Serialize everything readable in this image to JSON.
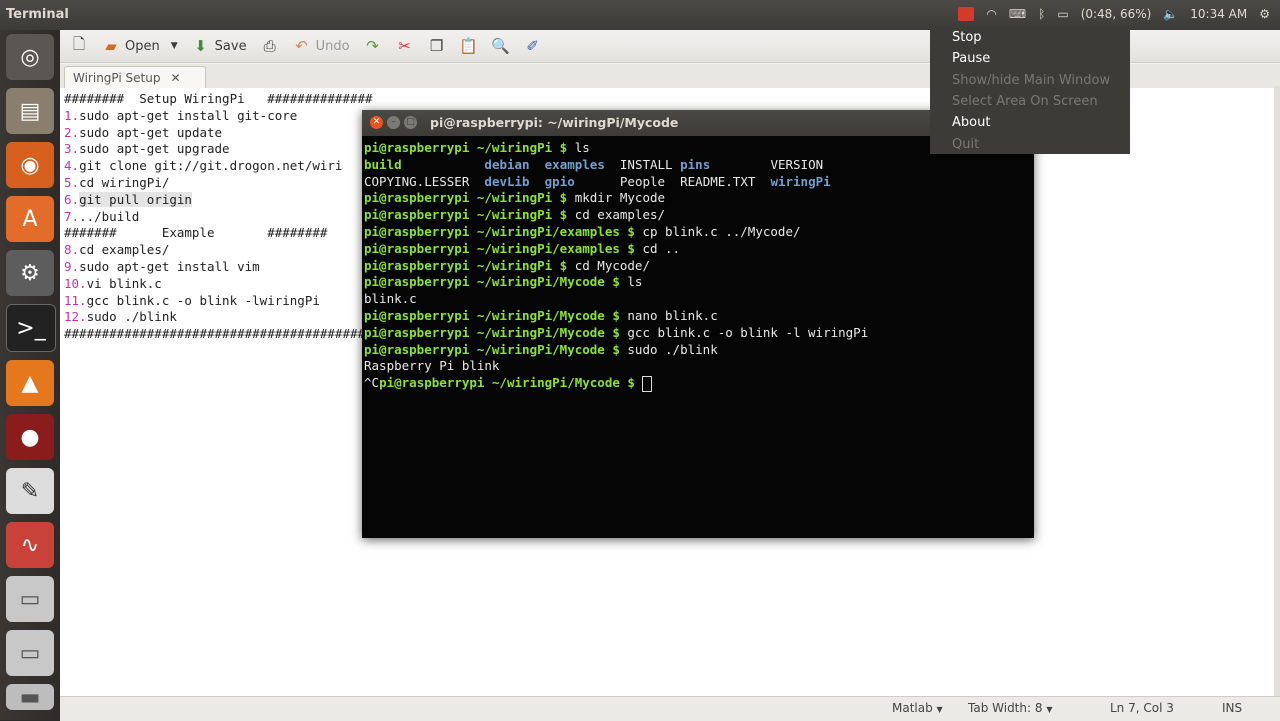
{
  "top_panel": {
    "title": "Terminal",
    "battery": "(0:48, 66%)",
    "time": "10:34 AM"
  },
  "toolbar": {
    "open_label": "Open",
    "save_label": "Save",
    "undo_label": "Undo"
  },
  "editor": {
    "tab_label": "WiringPi Setup",
    "lines": [
      {
        "t": "########  Setup WiringPi   ##############"
      },
      {
        "n": "1.",
        "t": "sudo apt-get install git-core"
      },
      {
        "n": "2.",
        "t": "sudo apt-get update"
      },
      {
        "n": "3.",
        "t": "sudo apt-get upgrade"
      },
      {
        "n": "4.",
        "t": "git clone git://git.drogon.net/wiri"
      },
      {
        "n": "5.",
        "t": "cd wiringPi/"
      },
      {
        "n": "6.",
        "t": "git pull origin",
        "hl": true
      },
      {
        "n": "7.",
        "t": "../build"
      },
      {
        "t": "#######      Example       ########"
      },
      {
        "n": "8.",
        "t": "cd examples/"
      },
      {
        "n": "9.",
        "t": "sudo apt-get install vim"
      },
      {
        "n": "10.",
        "t": "vi blink.c"
      },
      {
        "n": "11.",
        "t": "gcc blink.c -o blink -lwiringPi"
      },
      {
        "n": "12.",
        "t": "sudo ./blink"
      },
      {
        "t": "#############################################"
      }
    ],
    "status": {
      "language": "Matlab",
      "tab_width": "Tab Width: 8",
      "position": "Ln 7, Col 3",
      "mode": "INS"
    }
  },
  "terminal": {
    "title": "pi@raspberrypi: ~/wiringPi/Mycode",
    "ls_row1": [
      {
        "t": "build",
        "c": "g"
      },
      {
        "t": "debian",
        "c": "bl"
      },
      {
        "t": "examples",
        "c": "bl"
      },
      {
        "t": "INSTALL",
        "c": ""
      },
      {
        "t": "pins",
        "c": "bl"
      },
      {
        "t": "VERSION",
        "c": ""
      }
    ],
    "ls_row2": [
      {
        "t": "COPYING.LESSER",
        "c": ""
      },
      {
        "t": "devLib",
        "c": "bl"
      },
      {
        "t": "gpio",
        "c": "bl"
      },
      {
        "t": "People",
        "c": ""
      },
      {
        "t": "README.TXT",
        "c": ""
      },
      {
        "t": "wiringPi",
        "c": "bl"
      }
    ],
    "prompts": [
      {
        "p": "pi@raspberrypi",
        "d": "~/wiringPi",
        "c": "ls"
      },
      {
        "p": "pi@raspberrypi",
        "d": "~/wiringPi",
        "c": "mkdir Mycode"
      },
      {
        "p": "pi@raspberrypi",
        "d": "~/wiringPi",
        "c": "cd examples/"
      },
      {
        "p": "pi@raspberrypi",
        "d": "~/wiringPi/examples",
        "c": "cp blink.c ../Mycode/"
      },
      {
        "p": "pi@raspberrypi",
        "d": "~/wiringPi/examples",
        "c": "cd .."
      },
      {
        "p": "pi@raspberrypi",
        "d": "~/wiringPi",
        "c": "cd Mycode/"
      },
      {
        "p": "pi@raspberrypi",
        "d": "~/wiringPi/Mycode",
        "c": "ls"
      },
      {
        "p": "pi@raspberrypi",
        "d": "~/wiringPi/Mycode",
        "c": "nano blink.c"
      },
      {
        "p": "pi@raspberrypi",
        "d": "~/wiringPi/Mycode",
        "c": "gcc blink.c -o blink -l wiringPi"
      },
      {
        "p": "pi@raspberrypi",
        "d": "~/wiringPi/Mycode",
        "c": "sudo ./blink"
      }
    ],
    "ls_output": "blink.c",
    "program_output": "Raspberry Pi blink",
    "final_prefix": "^C",
    "final_prompt": "pi@raspberrypi",
    "final_dir": "~/wiringPi/Mycode"
  },
  "menu": {
    "items": [
      {
        "label": "Stop",
        "enabled": true
      },
      {
        "label": "Pause",
        "enabled": true
      },
      {
        "label": "Show/hide Main Window",
        "enabled": false
      },
      {
        "label": "Select Area On Screen",
        "enabled": false
      },
      {
        "label": "About",
        "enabled": true
      },
      {
        "label": "Quit",
        "enabled": false
      }
    ]
  }
}
